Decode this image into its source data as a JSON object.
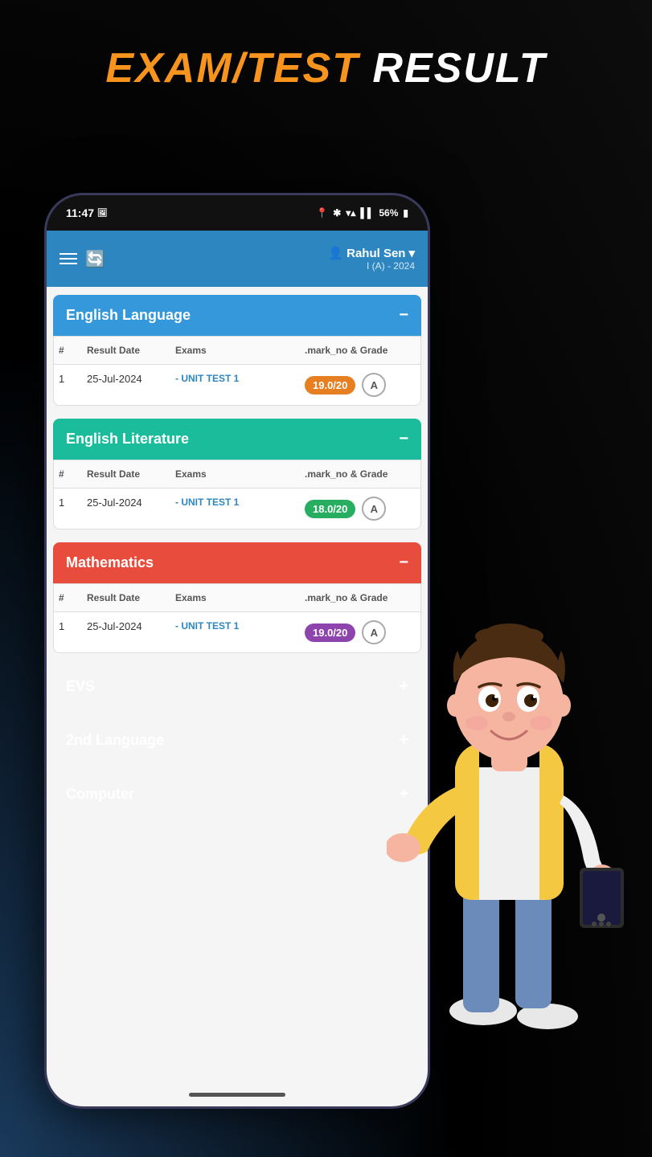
{
  "page": {
    "title_orange": "EXAM/TEST",
    "title_white": " RESULT"
  },
  "status_bar": {
    "time": "11:47",
    "battery": "56%"
  },
  "header": {
    "user_name": "Rahul Sen",
    "user_class": "I (A) - 2024",
    "refresh_label": "Refresh"
  },
  "subjects": [
    {
      "id": "english_language",
      "title": "English Language",
      "color": "blue",
      "expanded": true,
      "columns": [
        "#",
        "Result Date",
        "Exams",
        ".mark_no & Grade"
      ],
      "rows": [
        {
          "num": "1",
          "date": "25-Jul-2024",
          "exam": "- UNIT TEST 1",
          "mark": "19.0/20",
          "grade": "A",
          "mark_color": "orange-bg"
        }
      ]
    },
    {
      "id": "english_literature",
      "title": "English Literature",
      "color": "cyan",
      "expanded": true,
      "columns": [
        "#",
        "Result Date",
        "Exams",
        ".mark_no & Grade"
      ],
      "rows": [
        {
          "num": "1",
          "date": "25-Jul-2024",
          "exam": "- UNIT TEST 1",
          "mark": "18.0/20",
          "grade": "A",
          "mark_color": "green-bg"
        }
      ]
    },
    {
      "id": "mathematics",
      "title": "Mathematics",
      "color": "red",
      "expanded": true,
      "columns": [
        "#",
        "Result Date",
        "Exams",
        ".mark_no & Grade"
      ],
      "rows": [
        {
          "num": "1",
          "date": "25-Jul-2024",
          "exam": "- UNIT TEST 1",
          "mark": "19.0/20",
          "grade": "A",
          "mark_color": "purple-bg"
        }
      ]
    }
  ],
  "collapsed_sections": [
    {
      "id": "evs",
      "title": "EVS",
      "color": "green"
    },
    {
      "id": "2nd_language",
      "title": "2nd Language",
      "color": "orange"
    },
    {
      "id": "computer",
      "title": "Computer",
      "color": "steel"
    }
  ]
}
